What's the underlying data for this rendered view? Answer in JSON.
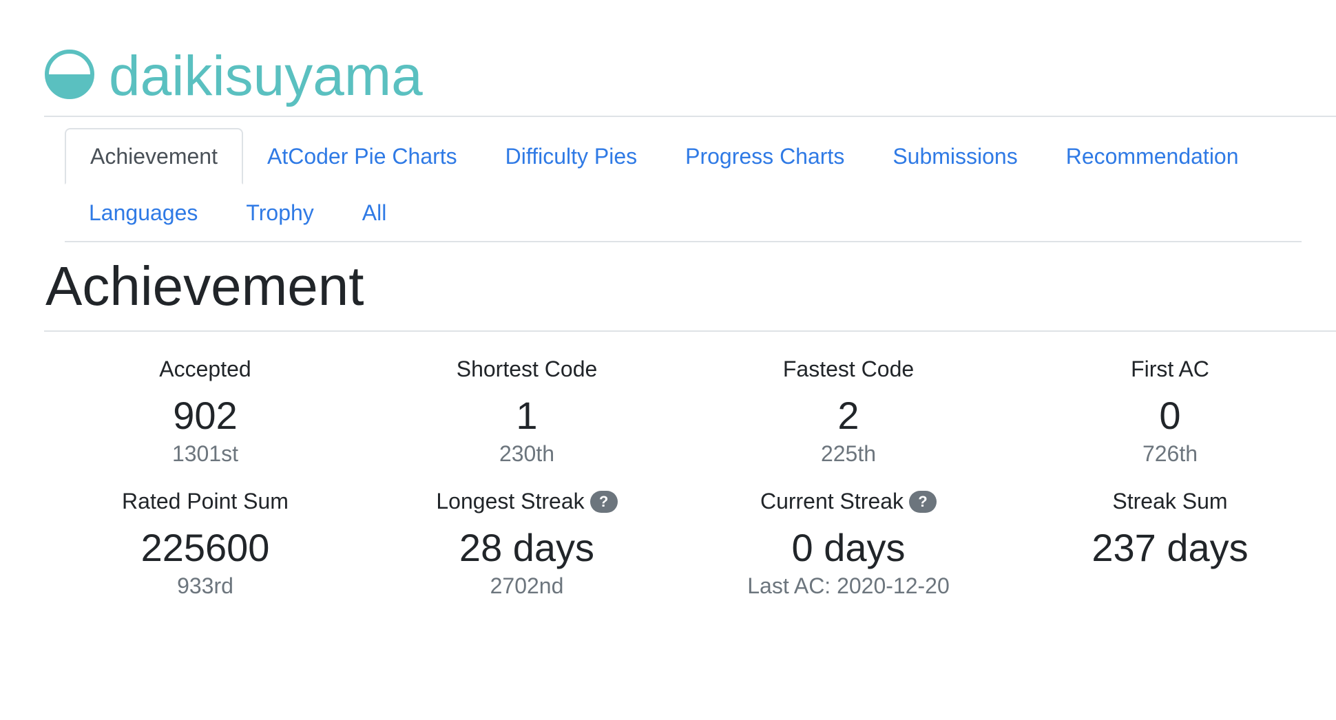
{
  "user": {
    "name": "daikisuyama",
    "rank_color": "#5ac0c0",
    "rank_icon": "half-filled-circle-icon"
  },
  "tabs": [
    {
      "label": "Achievement",
      "active": true
    },
    {
      "label": "AtCoder Pie Charts",
      "active": false
    },
    {
      "label": "Difficulty Pies",
      "active": false
    },
    {
      "label": "Progress Charts",
      "active": false
    },
    {
      "label": "Submissions",
      "active": false
    },
    {
      "label": "Recommendation",
      "active": false
    },
    {
      "label": "Languages",
      "active": false
    },
    {
      "label": "Trophy",
      "active": false
    },
    {
      "label": "All",
      "active": false
    }
  ],
  "section": {
    "title": "Achievement"
  },
  "stats": {
    "accepted": {
      "label": "Accepted",
      "value": "902",
      "rank": "1301st"
    },
    "shortest_code": {
      "label": "Shortest Code",
      "value": "1",
      "rank": "230th"
    },
    "fastest_code": {
      "label": "Fastest Code",
      "value": "2",
      "rank": "225th"
    },
    "first_ac": {
      "label": "First AC",
      "value": "0",
      "rank": "726th"
    },
    "rated_point_sum": {
      "label": "Rated Point Sum",
      "value": "225600",
      "rank": "933rd"
    },
    "longest_streak": {
      "label": "Longest Streak",
      "value": "28 days",
      "rank": "2702nd",
      "help": "?"
    },
    "current_streak": {
      "label": "Current Streak",
      "value": "0 days",
      "sub": "Last AC: 2020-12-20",
      "help": "?"
    },
    "streak_sum": {
      "label": "Streak Sum",
      "value": "237 days"
    }
  },
  "colors": {
    "link": "#2f7ae5",
    "muted": "#6c757d",
    "text": "#212529",
    "border": "#dee2e6"
  }
}
